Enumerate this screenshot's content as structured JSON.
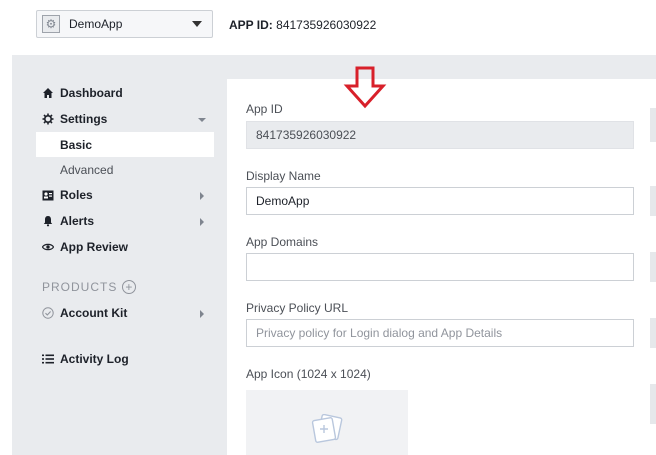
{
  "header": {
    "app_name": "DemoApp",
    "app_id_label": "APP ID:",
    "app_id_value": "841735926030922"
  },
  "sidebar": {
    "items": [
      {
        "label": "Dashboard",
        "icon": "home-icon"
      },
      {
        "label": "Settings",
        "icon": "gear-icon",
        "expanded": true
      },
      {
        "label": "Basic",
        "active": true
      },
      {
        "label": "Advanced"
      },
      {
        "label": "Roles",
        "icon": "roles-icon"
      },
      {
        "label": "Alerts",
        "icon": "bell-icon"
      },
      {
        "label": "App Review",
        "icon": "eye-icon"
      }
    ],
    "products_label": "PRODUCTS",
    "account_kit": "Account Kit",
    "activity_log": "Activity Log"
  },
  "form": {
    "app_id_label": "App ID",
    "app_id_value": "841735926030922",
    "display_name_label": "Display Name",
    "display_name_value": "DemoApp",
    "app_domains_label": "App Domains",
    "app_domains_value": "",
    "privacy_label": "Privacy Policy URL",
    "privacy_placeholder": "Privacy policy for Login dialog and App Details",
    "app_icon_label": "App Icon (1024 x 1024)"
  },
  "colors": {
    "accent_arrow": "#d8202a",
    "background": "#e9ebee"
  }
}
